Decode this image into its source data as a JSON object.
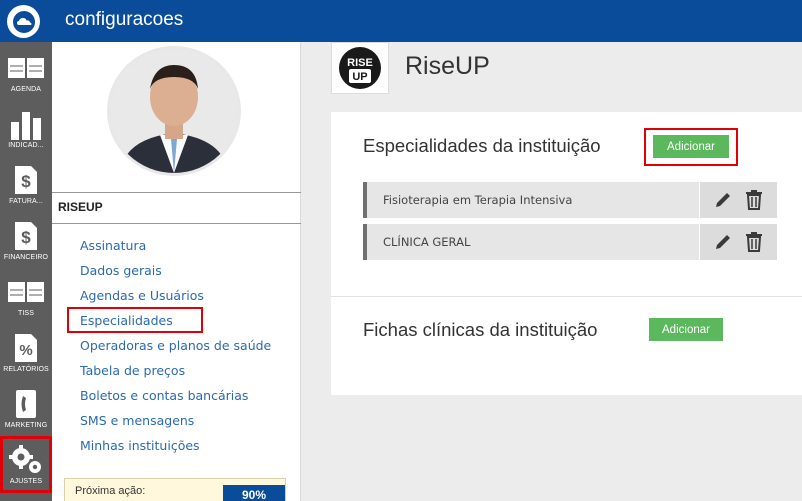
{
  "header": {
    "title": "configuracoes"
  },
  "rail": {
    "items": [
      {
        "label": "AGENDA"
      },
      {
        "label": "INDICAD..."
      },
      {
        "label": "FATURA..."
      },
      {
        "label": "FINANCEIRO"
      },
      {
        "label": "TISS"
      },
      {
        "label": "RELATÓRIOS"
      },
      {
        "label": "MARKETING"
      },
      {
        "label": "AJUSTES"
      }
    ]
  },
  "panel": {
    "section": "RISEUP",
    "menu": [
      "Assinatura",
      "Dados gerais",
      "Agendas e Usuários",
      "Especialidades",
      "Operadoras e planos de saúde",
      "Tabela de preços",
      "Boletos e contas bancárias",
      "SMS e mensagens",
      "Minhas instituições"
    ],
    "next_action": {
      "label": "Próxima ação:",
      "value": "90%"
    }
  },
  "institution": {
    "name": "RiseUP",
    "logo_text_top": "RISE",
    "logo_text_bottom": "UP"
  },
  "specialties": {
    "title": "Especialidades da instituição",
    "add_label": "Adicionar",
    "rows": [
      "Fisioterapia em Terapia Intensiva",
      "CLÍNICA GERAL"
    ]
  },
  "clinical_forms": {
    "title": "Fichas clínicas da instituição",
    "add_label": "Adicionar"
  },
  "colors": {
    "brand": "#0a4c9a",
    "rail": "#5d5d5d",
    "add_button": "#5cb85c",
    "highlight": "#e0000a",
    "link": "#2a6ab2"
  }
}
